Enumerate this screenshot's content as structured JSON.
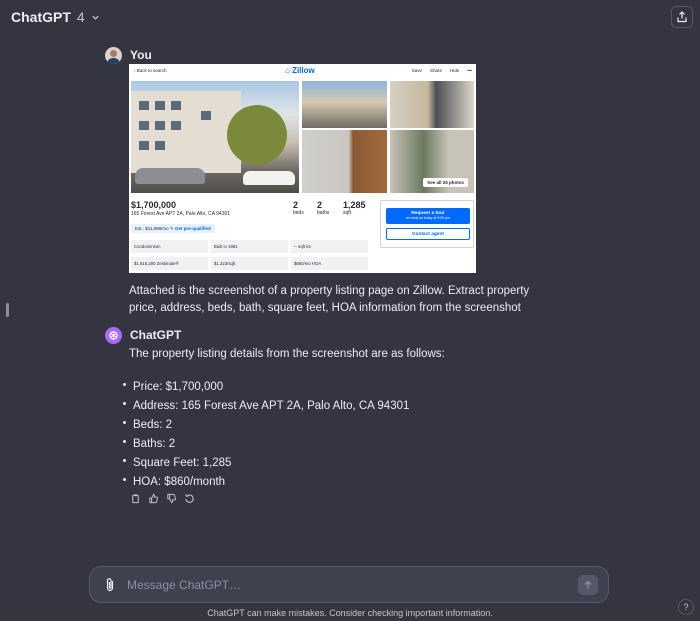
{
  "header": {
    "model_name": "ChatGPT",
    "model_version": "4"
  },
  "user_message": {
    "author": "You",
    "text": "Attached is the screenshot of a property listing page on Zillow. Extract property price, address, beds, bath, square feet, HOA information from the screenshot",
    "attachment": {
      "back_label": "Back to search",
      "logo": "Zillow",
      "actions": [
        "Save",
        "Share",
        "Hide",
        "•••"
      ],
      "see_all_label": "See all 25 photos",
      "price": "$1,700,000",
      "address": "165 Forest Ave APT 2A, Palo Alto, CA 94301",
      "stats": [
        {
          "value": "2",
          "label": "beds"
        },
        {
          "value": "2",
          "label": "baths"
        },
        {
          "value": "1,285",
          "label": "sqft"
        }
      ],
      "estimate": "Est.: $11,999/mo",
      "prequal_label": "Get pre-qualified",
      "facts": [
        "Condominium",
        "Built in 1981",
        "-- sqft lot",
        "$1,616,200 Zestimate®",
        "$1,323/sqft",
        "$860/mo HOA"
      ],
      "tour_label": "Request a tour",
      "tour_sub": "as early as today at 5:00 pm",
      "agent_label": "Contact agent"
    }
  },
  "assistant_message": {
    "author": "ChatGPT",
    "intro": "The property listing details from the screenshot are as follows:",
    "items": [
      "Price: $1,700,000",
      "Address: 165 Forest Ave APT 2A, Palo Alto, CA 94301",
      "Beds: 2",
      "Baths: 2",
      "Square Feet: 1,285",
      "HOA: $860/month"
    ],
    "actions": [
      "copy-icon",
      "thumbs-up-icon",
      "thumbs-down-icon",
      "regenerate-icon"
    ]
  },
  "composer": {
    "placeholder": "Message ChatGPT…"
  },
  "footer": {
    "disclaimer": "ChatGPT can make mistakes. Consider checking important information.",
    "help": "?"
  },
  "colors": {
    "background": "#343541",
    "composer": "#40414f",
    "accent_bot": "#ab68ff",
    "zillow_blue": "#006aff"
  }
}
